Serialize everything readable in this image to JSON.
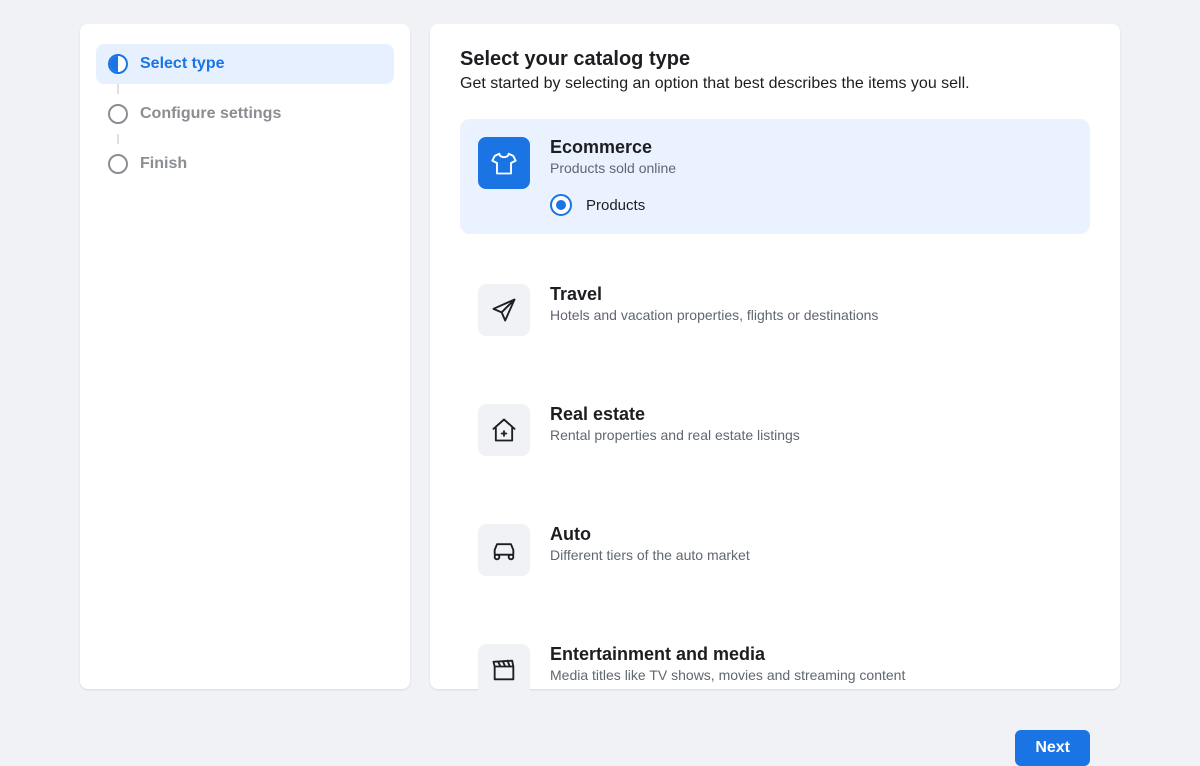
{
  "sidebar": {
    "steps": [
      {
        "label": "Select type",
        "active": true
      },
      {
        "label": "Configure settings",
        "active": false
      },
      {
        "label": "Finish",
        "active": false
      }
    ]
  },
  "main": {
    "title": "Select your catalog type",
    "subtitle": "Get started by selecting an option that best describes the items you sell.",
    "options": [
      {
        "title": "Ecommerce",
        "desc": "Products sold online",
        "selected": true,
        "radio_label": "Products"
      },
      {
        "title": "Travel",
        "desc": "Hotels and vacation properties, flights or destinations",
        "selected": false
      },
      {
        "title": "Real estate",
        "desc": "Rental properties and real estate listings",
        "selected": false
      },
      {
        "title": "Auto",
        "desc": "Different tiers of the auto market",
        "selected": false
      },
      {
        "title": "Entertainment and media",
        "desc": "Media titles like TV shows, movies and streaming content",
        "selected": false
      }
    ],
    "next_label": "Next"
  }
}
